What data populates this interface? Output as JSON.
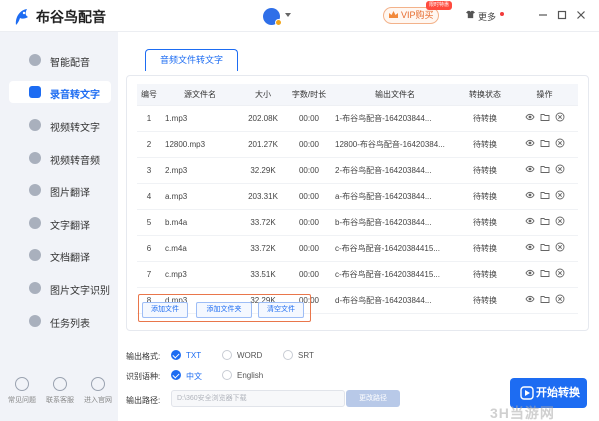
{
  "app": {
    "title": "布谷鸟配音"
  },
  "header": {
    "vip_label": "VIP购买",
    "vip_badge": "限时特惠",
    "more_label": "更多",
    "icons": [
      "logo-icon",
      "avatar-icon",
      "crown-icon",
      "shirt-icon",
      "minimize-icon",
      "maximize-icon",
      "close-icon"
    ]
  },
  "sidebar": {
    "items": [
      {
        "label": "智能配音",
        "icon": "microphone-icon",
        "active": false
      },
      {
        "label": "录音转文字",
        "icon": "audio-file-icon",
        "active": true
      },
      {
        "label": "视频转文字",
        "icon": "video-text-icon",
        "active": false
      },
      {
        "label": "视频转音频",
        "icon": "video-audio-icon",
        "active": false
      },
      {
        "label": "图片翻译",
        "icon": "image-icon",
        "active": false
      },
      {
        "label": "文字翻译",
        "icon": "translate-icon",
        "active": false
      },
      {
        "label": "文档翻译",
        "icon": "document-icon",
        "active": false
      },
      {
        "label": "图片文字识别",
        "icon": "ocr-icon",
        "active": false
      },
      {
        "label": "任务列表",
        "icon": "list-icon",
        "active": false
      }
    ],
    "bottom": [
      {
        "label": "常见问题",
        "icon": "question-icon"
      },
      {
        "label": "联系客服",
        "icon": "headset-icon"
      },
      {
        "label": "进入官网",
        "icon": "browser-icon"
      }
    ]
  },
  "main": {
    "tab_label": "音频文件转文字",
    "table": {
      "headers": [
        "编号",
        "源文件名",
        "大小",
        "字数/时长",
        "输出文件名",
        "转换状态",
        "操作"
      ],
      "rows": [
        [
          "1",
          "1.mp3",
          "202.08K",
          "00:00",
          "1-布谷鸟配音-164203844...",
          "待转换"
        ],
        [
          "2",
          "12800.mp3",
          "201.27K",
          "00:00",
          "12800-布谷鸟配音-16420384...",
          "待转换"
        ],
        [
          "3",
          "2.mp3",
          "32.29K",
          "00:00",
          "2-布谷鸟配音-164203844...",
          "待转换"
        ],
        [
          "4",
          "a.mp3",
          "203.31K",
          "00:00",
          "a-布谷鸟配音-164203844...",
          "待转换"
        ],
        [
          "5",
          "b.m4a",
          "33.72K",
          "00:00",
          "b-布谷鸟配音-164203844...",
          "待转换"
        ],
        [
          "6",
          "c.m4a",
          "33.72K",
          "00:00",
          "c-布谷鸟配音-16420384415...",
          "待转换"
        ],
        [
          "7",
          "c.mp3",
          "33.51K",
          "00:00",
          "c-布谷鸟配音-16420384415...",
          "待转换"
        ],
        [
          "8",
          "d.mp3",
          "32.29K",
          "00:00",
          "d-布谷鸟配音-164203844...",
          "待转换"
        ]
      ]
    },
    "actions": {
      "add_file": "添加文件",
      "add_folder": "添加文件夹",
      "clear": "清空文件"
    }
  },
  "settings": {
    "format_label": "输出格式:",
    "formats": [
      {
        "label": "TXT",
        "selected": true
      },
      {
        "label": "WORD",
        "selected": false
      },
      {
        "label": "SRT",
        "selected": false
      }
    ],
    "language_label": "识别语种:",
    "languages": [
      {
        "label": "中文",
        "selected": true
      },
      {
        "label": "English",
        "selected": false
      }
    ],
    "path_label": "输出路径:",
    "path_value": "D:\\360安全浏览器下载",
    "change_path": "更改路径",
    "start_label": "开始转换"
  },
  "watermark": "3H当游网",
  "colors": {
    "accent": "#1d6cf2",
    "highlight_border": "#e9764b",
    "sidebar_bg": "#f1f3f8"
  }
}
